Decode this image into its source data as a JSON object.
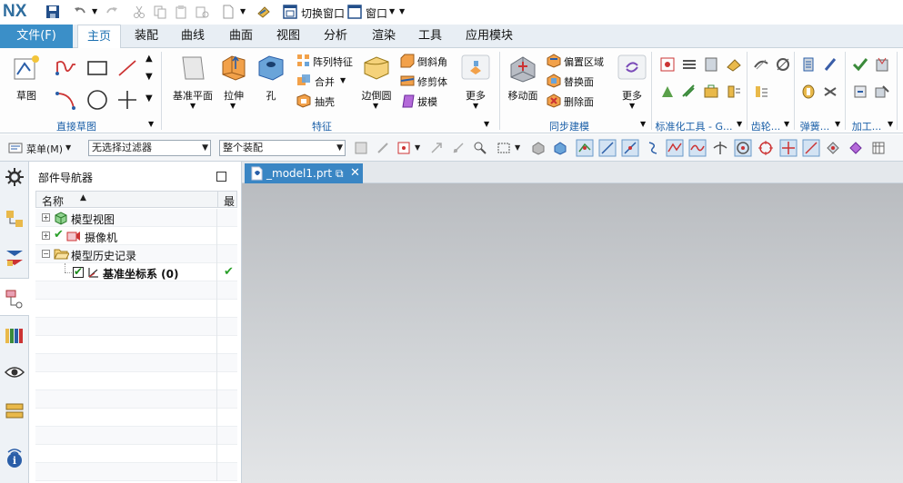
{
  "titlebar": {
    "logo": "NX",
    "switch_window_label": "切换窗口",
    "window_label": "窗口"
  },
  "tabs": {
    "file": "文件(F)",
    "items": [
      "主页",
      "装配",
      "曲线",
      "曲面",
      "视图",
      "分析",
      "渲染",
      "工具",
      "应用模块"
    ],
    "active": "主页"
  },
  "ribbon": {
    "sketch": "草图",
    "direct_sketch_group": "直接草图",
    "datum_plane": "基准平面",
    "extrude": "拉伸",
    "hole": "孔",
    "pattern_feature": "阵列特征",
    "unite": "合并",
    "shell": "抽壳",
    "edge_blend": "边倒圆",
    "chamfer": "倒斜角",
    "trim_body": "修剪体",
    "draft": "拔模",
    "more": "更多",
    "feature_group": "特征",
    "move_face": "移动面",
    "offset_region": "偏置区域",
    "replace_face": "替换面",
    "delete_face": "删除面",
    "more2": "更多",
    "sync_group": "同步建模",
    "std_tools_group": "标准化工具 - G...",
    "gear_group": "齿轮...",
    "spring_group": "弹簧...",
    "machining_group": "加工..."
  },
  "toolbar2": {
    "menu_label": "菜单(M)",
    "filter_value": "无选择过滤器",
    "assembly_value": "整个装配"
  },
  "navigator": {
    "title": "部件导航器",
    "col_name": "名称",
    "col_latest": "最",
    "rows": [
      {
        "label": "模型视图"
      },
      {
        "label": "摄像机"
      },
      {
        "label": "模型历史记录"
      },
      {
        "label": "基准坐标系 (0)"
      }
    ]
  },
  "document": {
    "tab_label": "_model1.prt"
  },
  "colors": {
    "accent": "#3b8fc8",
    "ribbon_group_label": "#1a5fa8"
  }
}
